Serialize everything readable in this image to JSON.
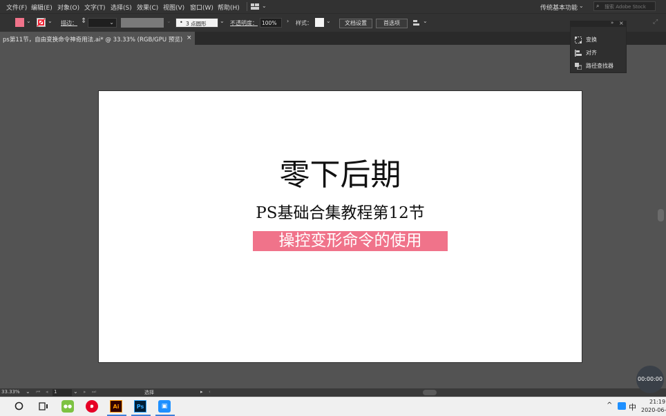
{
  "menu": {
    "items": [
      "文件(F)",
      "编辑(E)",
      "对象(O)",
      "文字(T)",
      "选择(S)",
      "效果(C)",
      "视图(V)",
      "窗口(W)",
      "帮助(H)"
    ],
    "workspace": "传统基本功能",
    "search_placeholder": "搜索 Adobe Stock"
  },
  "controlbar": {
    "stroke_label": "描边：",
    "brush_label": "3 点圆形",
    "opacity_label": "不透明度：",
    "opacity_value": "100%",
    "style_label": "样式：",
    "doc_setup_button": "文档设置",
    "prefs_button": "首选项",
    "fill_color": "#f0738a"
  },
  "tab": {
    "title": "ps第11节，自由变换命令神奇用法.ai* @ 33.33% (RGB/GPU 预览)",
    "close": "×"
  },
  "artboard": {
    "title": "零下后期",
    "subtitle": "PS基础合集教程第12节",
    "highlight": "操控变形命令的使用",
    "highlight_color": "#f0738a"
  },
  "panel": {
    "items": [
      "变换",
      "对齐",
      "路径查找器"
    ]
  },
  "statusbar": {
    "zoom": "33.33%",
    "page": "1",
    "tool": "选择"
  },
  "taskbar": {
    "time": "21:19",
    "date": "2020-06-",
    "ime": "中"
  },
  "recorder": {
    "timer": "00:00:00"
  }
}
